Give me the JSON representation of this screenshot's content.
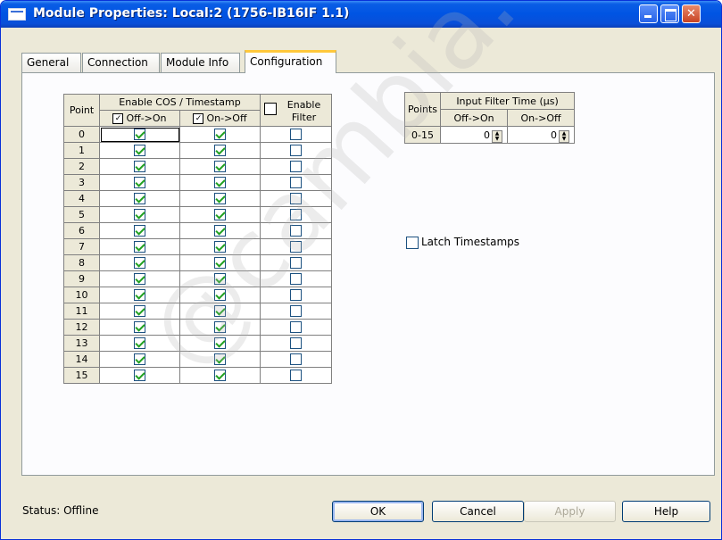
{
  "window": {
    "title": "Module Properties: Local:2 (1756-IB16IF 1.1)"
  },
  "tabs": [
    {
      "label": "General"
    },
    {
      "label": "Connection"
    },
    {
      "label": "Module Info"
    },
    {
      "label": "Configuration",
      "active": true
    }
  ],
  "grid": {
    "header_point": "Point",
    "header_cos": "Enable COS / Timestamp",
    "header_off_on": "Off->On",
    "header_on_off": "On->Off",
    "header_filter": "Enable\nFilter",
    "rows": [
      {
        "point": "0",
        "off_on": true,
        "on_off": true,
        "filter": false
      },
      {
        "point": "1",
        "off_on": true,
        "on_off": true,
        "filter": false
      },
      {
        "point": "2",
        "off_on": true,
        "on_off": true,
        "filter": false
      },
      {
        "point": "3",
        "off_on": true,
        "on_off": true,
        "filter": false
      },
      {
        "point": "4",
        "off_on": true,
        "on_off": true,
        "filter": false
      },
      {
        "point": "5",
        "off_on": true,
        "on_off": true,
        "filter": false
      },
      {
        "point": "6",
        "off_on": true,
        "on_off": true,
        "filter": false
      },
      {
        "point": "7",
        "off_on": true,
        "on_off": true,
        "filter": false
      },
      {
        "point": "8",
        "off_on": true,
        "on_off": true,
        "filter": false
      },
      {
        "point": "9",
        "off_on": true,
        "on_off": true,
        "filter": false
      },
      {
        "point": "10",
        "off_on": true,
        "on_off": true,
        "filter": false
      },
      {
        "point": "11",
        "off_on": true,
        "on_off": true,
        "filter": false
      },
      {
        "point": "12",
        "off_on": true,
        "on_off": true,
        "filter": false
      },
      {
        "point": "13",
        "off_on": true,
        "on_off": true,
        "filter": false
      },
      {
        "point": "14",
        "off_on": true,
        "on_off": true,
        "filter": false
      },
      {
        "point": "15",
        "off_on": true,
        "on_off": true,
        "filter": false
      }
    ]
  },
  "filter_table": {
    "header_points": "Points",
    "header_time": "Input Filter Time (µs)",
    "header_off_on": "Off->On",
    "header_on_off": "On->Off",
    "row_points": "0-15",
    "off_on_value": "0",
    "on_off_value": "0"
  },
  "latch": {
    "label": "Latch Timestamps",
    "checked": false
  },
  "status": {
    "text": "Status:  Offline"
  },
  "buttons": {
    "ok": "OK",
    "cancel": "Cancel",
    "apply": "Apply",
    "help": "Help"
  },
  "colors": {
    "titlebar": "#0054e3",
    "dialog_bg": "#ece9d8",
    "check": "#21a121",
    "active_tab_accent": "#ffc83c"
  },
  "watermark": "@cambia.c"
}
